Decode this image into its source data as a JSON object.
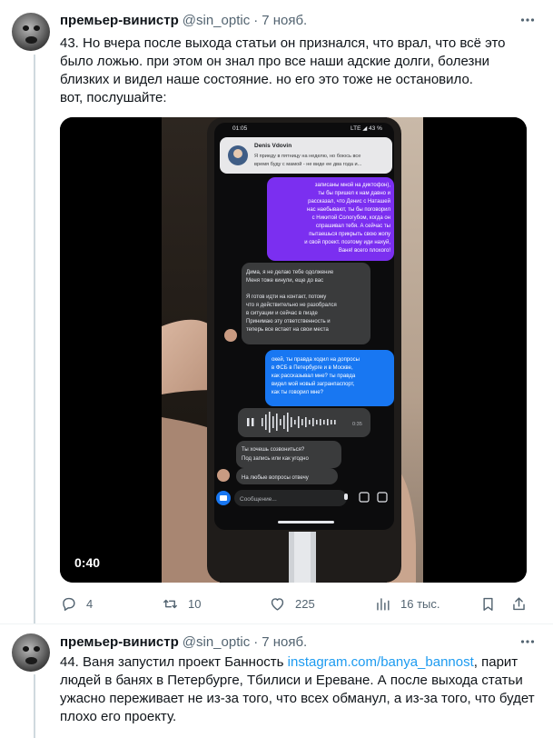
{
  "tweets": [
    {
      "author_name": "премьер-винистр",
      "handle": "@sin_optic",
      "separator": "·",
      "date": "7 нояб.",
      "lines": [
        "43. Но вчера после выхода статьи он признался, что врал, что всё это",
        "было ложью. при этом он знал про все наши адские долги, болезни",
        "близких и видел наше состояние. но его это тоже не остановило.",
        "вот, послушайте:"
      ],
      "video": {
        "duration": "0:40",
        "status_time": "01:05",
        "status_right": "LTE ◢ 43 %",
        "notif_name": "Denis Vdovin",
        "notif_line1": "Я приеду в пятницу на неделю, но боюсь все",
        "notif_line2": "время буду с мамой - не виде ее два года и...",
        "bubble_purple": [
          "записаны мной на диктофон),",
          "ты бы пришел к нам давно и",
          "рассказал, что Денис с Наташей",
          "нас наебывают, ты бы поговорил",
          "с Никитой Сологубом, когда он",
          "спрашивал тебя. А сейчас ты",
          "пытаешься прикрыть свою жопу",
          "и свой проект. поэтому иди нахуй,",
          "Ваня! всего плохого!"
        ],
        "bubble_gray": [
          "Дима, я не делаю тебе одолжение",
          "Меня тоже кинули, еще до вас",
          "",
          "Я готов идти на контакт, потому",
          "что я действительно не разобрался",
          "в ситуации и сейчас в пизде",
          "Принимаю эту ответственность и",
          "теперь все встает на свои места"
        ],
        "bubble_blue": [
          "окей, ты правда ходил на допросы",
          "в ФСБ в Петербурге и в Москве,",
          "как рассказывал мне? ты правда",
          "видел мой новый загранпаспорт,",
          "как ты говорил мне?"
        ],
        "voice_time": "0:35",
        "bubble_q": [
          "Ты хочешь созвониться?",
          "Под запись или как угодно"
        ],
        "bubble_last": "На любые вопросы отвечу",
        "input_placeholder": "Сообщение..."
      },
      "actions": {
        "replies": "4",
        "retweets": "10",
        "likes": "225",
        "views": "16 тыс."
      }
    },
    {
      "author_name": "премьер-винистр",
      "handle": "@sin_optic",
      "separator": "·",
      "date": "7 нояб.",
      "line1_prefix": "44. Ваня запустил проект Банность ",
      "line1_link": "instagram.com/banya_bannost",
      "line1_suffix": ", парит",
      "lines": [
        "людей в банях в Петербурге, Тбилиси и Ереване. А после выхода статьи",
        "ужасно переживает не из-за того, что всех обманул, а из-за того, что будет",
        "плохо его проекту."
      ]
    }
  ],
  "icons": {
    "more": "more-icon",
    "reply": "reply-icon",
    "retweet": "retweet-icon",
    "like": "like-icon",
    "views": "views-icon",
    "bookmark": "bookmark-icon",
    "share": "share-icon"
  },
  "colors": {
    "accent": "#1d9bf0",
    "secondary_text": "#536471",
    "bubble_purple": "#7b2ff0",
    "bubble_blue": "#1877f2",
    "bubble_gray": "#3a3b3c"
  }
}
